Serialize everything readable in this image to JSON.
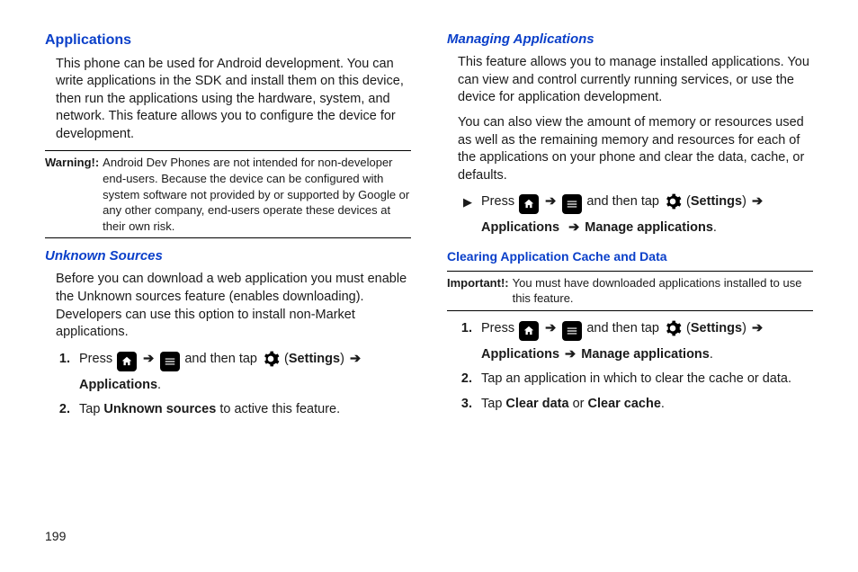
{
  "pageNumber": "199",
  "left": {
    "h1": "Applications",
    "intro": "This phone can be used for Android development. You can write applications in the SDK and install them on this device, then run the applications using the hardware, system, and network. This feature allows you to configure the device for development.",
    "warningLabel": "Warning!:",
    "warningBody": "Android Dev Phones are not intended for non-developer end-users. Because the device can be configured with system software not provided by or supported by Google or any other company, end-users operate these devices at their own risk.",
    "h2": "Unknown Sources",
    "p2": "Before you can download a web application you must enable the Unknown sources feature (enables downloading). Developers can use this option to install non-Market applications.",
    "step1_press": "Press ",
    "step1_andthen": " and then tap ",
    "step1_settings": "Settings",
    "step1_apps": "Applications",
    "step2_a": "Tap ",
    "step2_b": "Unknown sources",
    "step2_c": " to active this feature."
  },
  "right": {
    "h2a": "Managing Applications",
    "p1": "This feature allows you to manage installed applications. You can view and control currently running services, or use the device for application development.",
    "p2": "You can also view the amount of memory or resources used as well as the remaining memory and resources for each of the applications on your phone and clear the data, cache, or defaults.",
    "bullet_press": "Press ",
    "bullet_andthen": " and then tap ",
    "bullet_settings": "Settings",
    "bullet_apps": "Applications",
    "bullet_manage": "Manage applications",
    "h3": "Clearing Application Cache and Data",
    "importantLabel": "Important!:",
    "importantBody": "You must have downloaded applications installed to use this feature.",
    "s1_press": "Press ",
    "s1_andthen": " and then tap ",
    "s1_settings": "Settings",
    "s1_apps": "Applications",
    "s1_manage": "Manage applications",
    "s2": "Tap an application in which to clear the cache or data.",
    "s3_a": "Tap ",
    "s3_b": "Clear data",
    "s3_c": " or ",
    "s3_d": "Clear cache",
    "s3_e": "."
  }
}
